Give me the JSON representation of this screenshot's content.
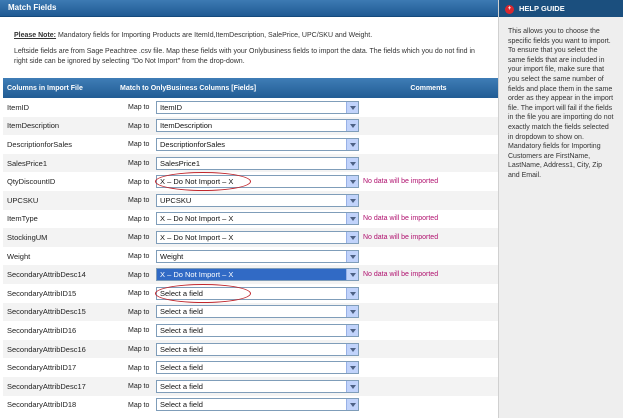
{
  "header": {
    "title": "Match Fields"
  },
  "note": {
    "label": "Please Note:",
    "text": " Mandatory fields for Importing Products are ItemId,ItemDescription, SalePrice, UPC/SKU and Weight.",
    "instructions": "Leftside fields are from Sage Peachtree .csv file. Map these fields with your Onlybusiness fields to import the data. The fields which you do not find in right side can be ignored by selecting \"Do Not Import\" from the drop-down."
  },
  "table": {
    "headers": {
      "col1": "Columns in Import File",
      "col2": "Match to OnlyBusiness Columns [Fields]",
      "col3": "Comments"
    },
    "map_label": "Map to",
    "rows": [
      {
        "column": "ItemID",
        "value": "ItemID",
        "comment": "",
        "highlight": false,
        "circled": false
      },
      {
        "column": "ItemDescription",
        "value": "ItemDescription",
        "comment": "",
        "highlight": false,
        "circled": false
      },
      {
        "column": "DescriptionforSales",
        "value": "DescriptionforSales",
        "comment": "",
        "highlight": false,
        "circled": false
      },
      {
        "column": "SalesPrice1",
        "value": "SalesPrice1",
        "comment": "",
        "highlight": false,
        "circled": false
      },
      {
        "column": "QtyDiscountID",
        "value": "X – Do Not Import – X",
        "comment": "No data will be imported",
        "highlight": false,
        "circled": true
      },
      {
        "column": "UPCSKU",
        "value": "UPCSKU",
        "comment": "",
        "highlight": false,
        "circled": false
      },
      {
        "column": "ItemType",
        "value": "X – Do Not Import – X",
        "comment": "No data will be imported",
        "highlight": false,
        "circled": false
      },
      {
        "column": "StockingUM",
        "value": "X – Do Not Import – X",
        "comment": "No data will be imported",
        "highlight": false,
        "circled": false
      },
      {
        "column": "Weight",
        "value": "Weight",
        "comment": "",
        "highlight": false,
        "circled": false
      },
      {
        "column": "SecondaryAttribDesc14",
        "value": "X – Do Not Import – X",
        "comment": "No data will be imported",
        "highlight": true,
        "circled": false
      },
      {
        "column": "SecondaryAttribID15",
        "value": "Select a field",
        "comment": "",
        "highlight": false,
        "circled": true
      },
      {
        "column": "SecondaryAttribDesc15",
        "value": "Select a field",
        "comment": "",
        "highlight": false,
        "circled": false
      },
      {
        "column": "SecondaryAttribID16",
        "value": "Select a field",
        "comment": "",
        "highlight": false,
        "circled": false
      },
      {
        "column": "SecondaryAttribDesc16",
        "value": "Select a field",
        "comment": "",
        "highlight": false,
        "circled": false
      },
      {
        "column": "SecondaryAttribID17",
        "value": "Select a field",
        "comment": "",
        "highlight": false,
        "circled": false
      },
      {
        "column": "SecondaryAttribDesc17",
        "value": "Select a field",
        "comment": "",
        "highlight": false,
        "circled": false
      },
      {
        "column": "SecondaryAttribID18",
        "value": "Select a field",
        "comment": "",
        "highlight": false,
        "circled": false
      }
    ]
  },
  "help": {
    "title": "HELP GUIDE",
    "icon": "help-icon",
    "text": "This allows you to choose the specific fields you want to import. To ensure that you select the same fields that are included in your import file, make sure that you select the same number of fields and place them in the same order as they appear in the import file. The import will fail if the fields in the file you are importing do not exactly match the fields selected in dropdown to show on. Mandatory fields for Importing Customers are FirstName, LastName, Address1, City, Zip and Email."
  },
  "colors": {
    "header_blue": "#1f5a93",
    "comment_magenta": "#b0106e",
    "highlight_blue": "#316ac5",
    "circle_red": "#c0272d"
  }
}
